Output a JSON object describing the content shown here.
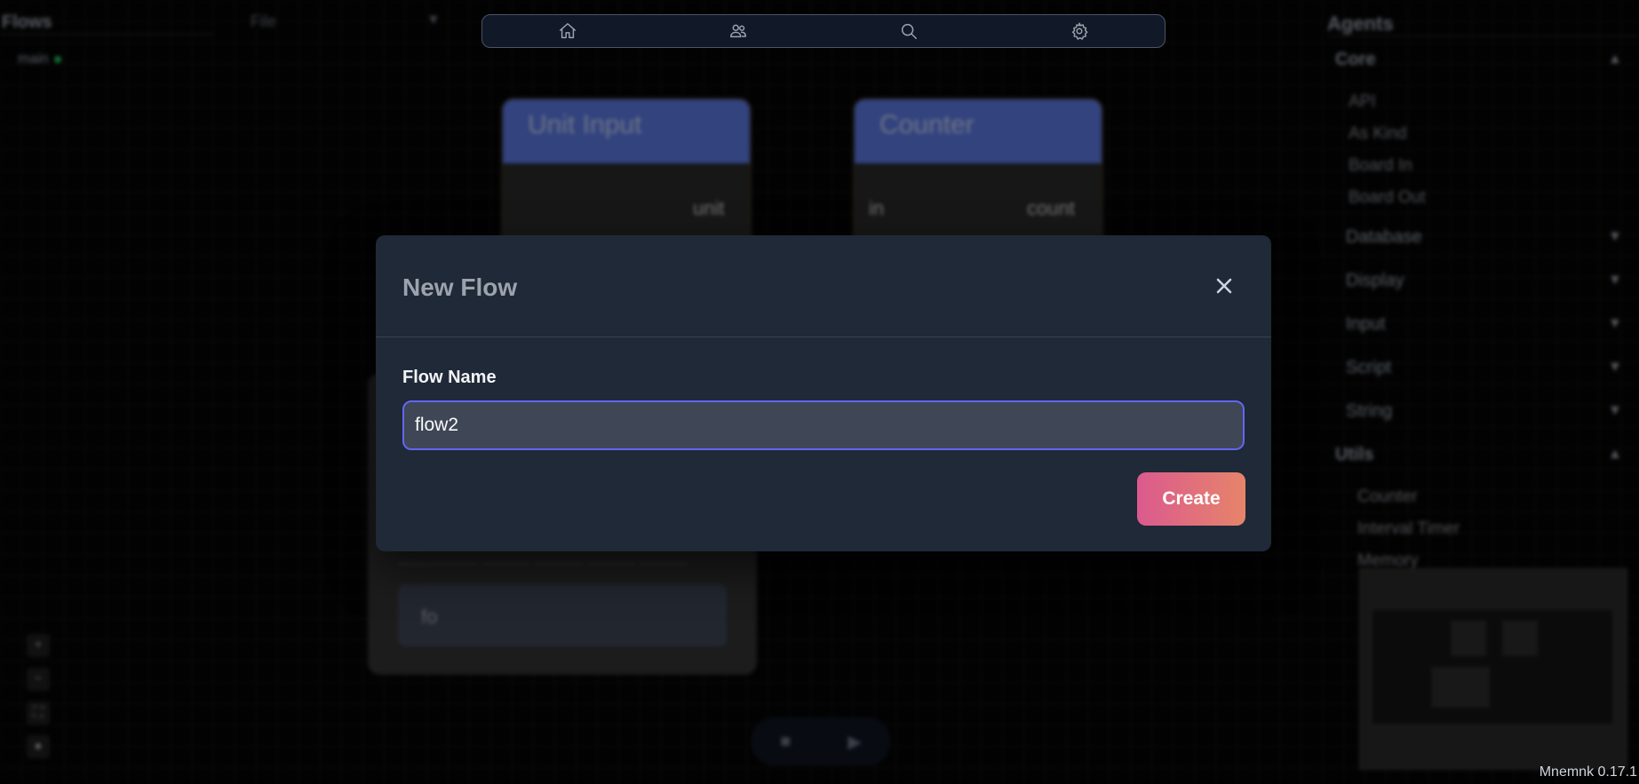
{
  "flows_panel": {
    "title": "Flows",
    "file_menu": "File",
    "items": [
      {
        "label": "main",
        "active": true
      }
    ]
  },
  "top_nav": {
    "icons": [
      "home-icon",
      "users-icon",
      "search-icon",
      "gear-icon"
    ]
  },
  "canvas": {
    "nodes": [
      {
        "title": "Unit Input",
        "ports": [
          "unit"
        ]
      },
      {
        "title": "Counter",
        "ports": [
          "in",
          "count"
        ]
      }
    ],
    "large_node": {
      "input_value": "fo"
    }
  },
  "agents_panel": {
    "title": "Agents",
    "core_label": "Core",
    "core_items": [
      "API",
      "As Kind",
      "Board In",
      "Board Out"
    ],
    "categories": [
      "Database",
      "Display",
      "Input",
      "Script",
      "String"
    ],
    "utils_label": "Utils",
    "utils_items": [
      "Counter",
      "Interval Timer",
      "Memory"
    ]
  },
  "dialog": {
    "title": "New Flow",
    "field_label": "Flow Name",
    "field_value": "flow2",
    "create_label": "Create"
  },
  "version": "Mnemnk 0.17.1",
  "colors": {
    "accent_border": "#6366f1",
    "button_gradient_start": "#db5a8e",
    "button_gradient_end": "#e6846a",
    "node_header": "#5b7ae6"
  }
}
